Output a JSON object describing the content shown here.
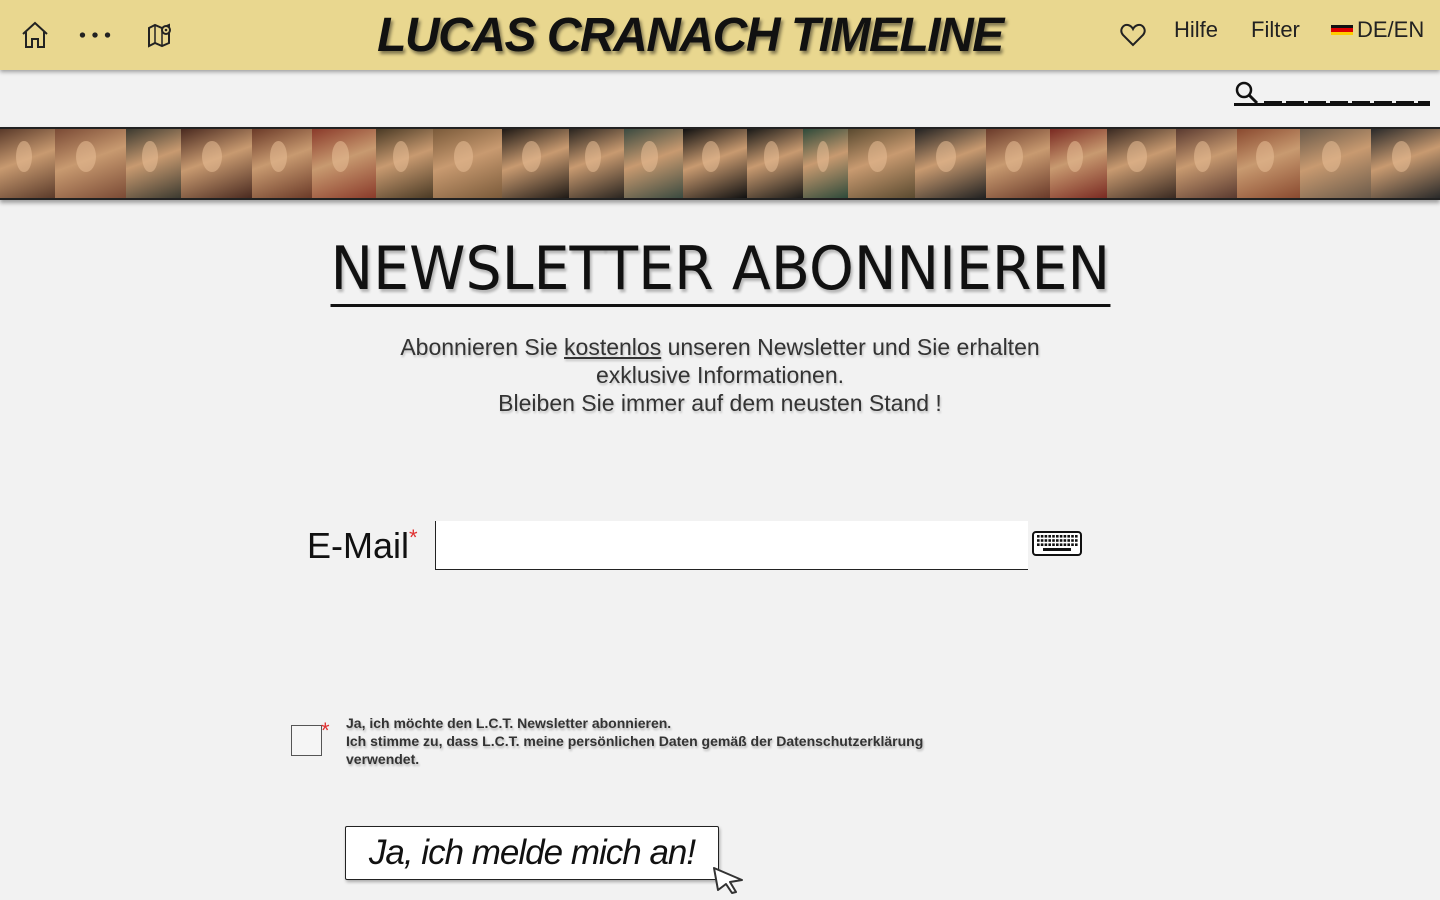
{
  "header": {
    "title": "LUCAS CRANACH TIMELINE",
    "hilfe": "Hilfe",
    "filter": "Filter",
    "lang": "DE/EN",
    "icons": [
      "home-icon",
      "more-icon",
      "map-icon",
      "heart-icon",
      "flag-de-icon"
    ]
  },
  "search": {
    "placeholder": "",
    "icon": "search-icon"
  },
  "strip": {
    "tiles": [
      {
        "color": "#5a3a2a"
      },
      {
        "color": "#7a4a35"
      },
      {
        "color": "#3c3a30"
      },
      {
        "color": "#4a2a20"
      },
      {
        "color": "#6b3a28"
      },
      {
        "color": "#8a3a2a"
      },
      {
        "color": "#4a3a25"
      },
      {
        "color": "#7a5a3a"
      },
      {
        "color": "#1f1a16"
      },
      {
        "color": "#2a2520"
      },
      {
        "color": "#3a4a40"
      },
      {
        "color": "#111111"
      },
      {
        "color": "#1a1a18"
      },
      {
        "color": "#2e4a3a"
      },
      {
        "color": "#5a4a30"
      },
      {
        "color": "#222222"
      },
      {
        "color": "#6a3a2a"
      },
      {
        "color": "#7a2a22"
      },
      {
        "color": "#3a2a22"
      },
      {
        "color": "#5a3a30"
      },
      {
        "color": "#8a4a30"
      },
      {
        "color": "#6a5a4a"
      },
      {
        "color": "#2a2a2a"
      }
    ]
  },
  "main": {
    "heading": "NEWSLETTER ABONNIEREN",
    "intro_line1_pre": "Abonnieren Sie ",
    "intro_line1_link": "kostenlos",
    "intro_line1_post": " unseren Newsletter und Sie erhalten",
    "intro_line2": "exklusive Informationen.",
    "intro_line3": "Bleiben Sie immer auf dem neusten Stand !",
    "email_label": "E-Mail",
    "required_mark": "*",
    "email_value": "",
    "consent_line1": "Ja, ich möchte den L.C.T. Newsletter abonnieren.",
    "consent_line2": "Ich stimme zu, dass L.C.T. meine persönlichen Daten gemäß der Datenschutzerklärung verwendet.",
    "submit_label": "Ja, ich melde mich an!"
  },
  "colors": {
    "header_bg": "#e9d78f",
    "page_bg": "#f2f2f2",
    "required": "#e03030"
  }
}
